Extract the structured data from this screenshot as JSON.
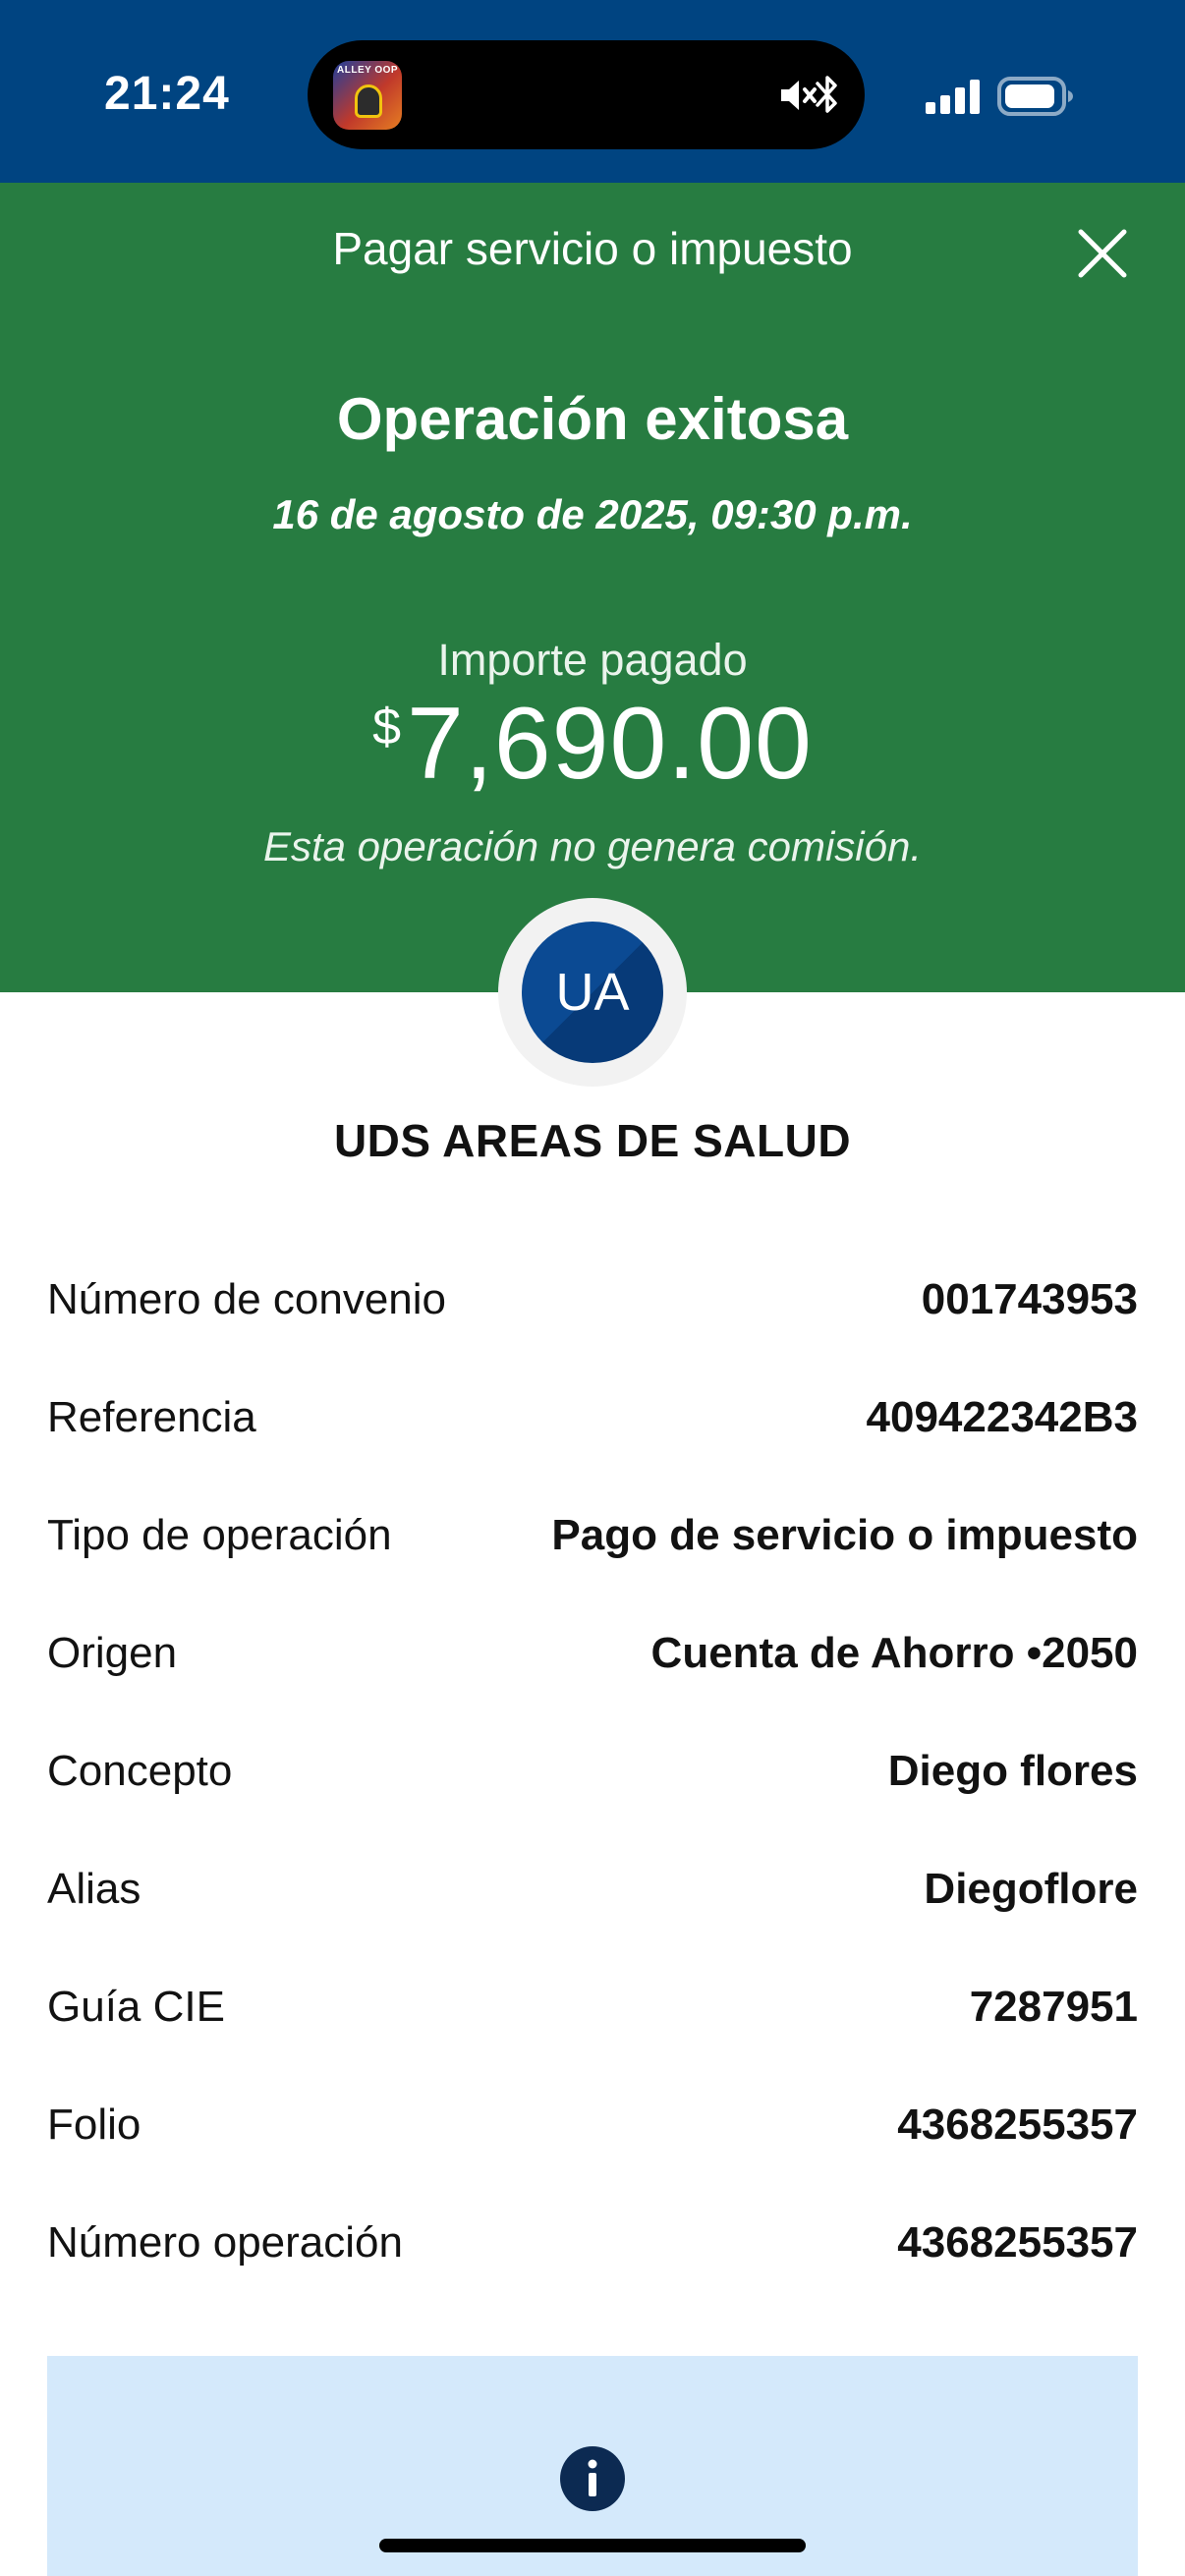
{
  "status_bar": {
    "time": "21:24",
    "app_icon_caption": "ALLEY OOP"
  },
  "header": {
    "title": "Pagar servicio o impuesto"
  },
  "result": {
    "title": "Operación exitosa",
    "date": "16 de agosto de 2025, 09:30 p.m.",
    "amount_label": "Importe pagado",
    "currency_symbol": "$",
    "amount": "7,690.00",
    "commission_note": "Esta operación no genera comisión."
  },
  "beneficiary": {
    "initials": "UA",
    "name": "UDS AREAS DE SALUD"
  },
  "details": [
    {
      "label": "Número de convenio",
      "value": "001743953"
    },
    {
      "label": "Referencia",
      "value": "409422342B3"
    },
    {
      "label": "Tipo de operación",
      "value": "Pago de servicio o impuesto"
    },
    {
      "label": "Origen",
      "value": "Cuenta de Ahorro •2050"
    },
    {
      "label": "Concepto",
      "value": "Diego flores"
    },
    {
      "label": "Alias",
      "value": "Diegoflore"
    },
    {
      "label": "Guía CIE",
      "value": "7287951"
    },
    {
      "label": "Folio",
      "value": "4368255357"
    },
    {
      "label": "Número operación",
      "value": "4368255357"
    }
  ],
  "icons": {
    "close": "close-icon",
    "info": "info-icon",
    "mute": "mute-icon",
    "bluetooth": "bluetooth-icon",
    "signal": "signal-icon",
    "battery": "battery-icon"
  },
  "colors": {
    "status_bar_bg": "#004481",
    "success_green": "#277c41",
    "avatar_blue": "#0b4a93",
    "info_box_bg": "#d4e9fb",
    "info_icon": "#0c2a52"
  }
}
